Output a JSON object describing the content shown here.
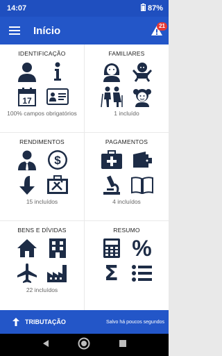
{
  "status": {
    "time": "14:07",
    "battery": "87%"
  },
  "appbar": {
    "title": "Início",
    "alert_count": "21"
  },
  "cards": {
    "identificacao": {
      "title": "IDENTIFICAÇÃO",
      "subtitle": "100% campos obrigatórios",
      "icons": [
        "person-icon",
        "info-icon",
        "calendar-icon",
        "id-card-icon"
      ],
      "calendar_day": "17"
    },
    "familiares": {
      "title": "FAMILIARES",
      "subtitle": "1 incluído",
      "icons": [
        "woman-icon",
        "baby-icon",
        "elderly-couple-icon",
        "girl-icon"
      ]
    },
    "rendimentos": {
      "title": "RENDIMENTOS",
      "subtitle": "15 incluídos",
      "icons": [
        "businessman-icon",
        "dollar-icon",
        "down-arrow-icon",
        "toolbox-icon"
      ]
    },
    "pagamentos": {
      "title": "PAGAMENTOS",
      "subtitle": "4 incluídos",
      "icons": [
        "medical-kit-icon",
        "wallet-icon",
        "microscope-icon",
        "book-icon"
      ]
    },
    "bens": {
      "title": "BENS E DÍVIDAS",
      "subtitle": "22 incluídos",
      "icons": [
        "house-icon",
        "building-icon",
        "airplane-icon",
        "factory-icon"
      ]
    },
    "resumo": {
      "title": "RESUMO",
      "subtitle": "",
      "icons": [
        "calculator-icon",
        "percent-icon",
        "sigma-icon",
        "list-icon"
      ],
      "percent_symbol": "%",
      "sigma_symbol": "Σ"
    }
  },
  "bottom": {
    "label": "TRIBUTAÇÃO",
    "saved": "Salvo há poucos segundos"
  }
}
